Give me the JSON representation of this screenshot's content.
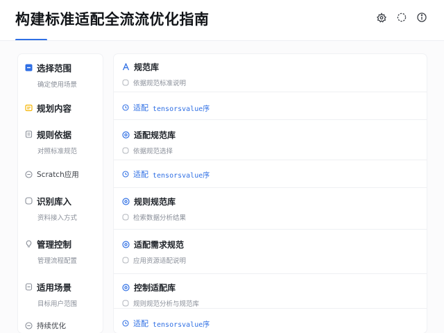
{
  "header": {
    "title": "构建标准适配全流流优化指南",
    "icons": [
      "settings-icon",
      "refresh-icon",
      "info-icon"
    ]
  },
  "sidebar": {
    "items": [
      {
        "label": "选择范围",
        "sub": "确定使用场景",
        "icon": "checkbox-icon",
        "accent": "#2f6fe4"
      },
      {
        "label": "规划内容",
        "sub": "",
        "icon": "note-icon",
        "accent": "#f5b400"
      },
      {
        "label": "规则依据",
        "sub": "对照标准规范",
        "icon": "doc-icon",
        "accent": "#8a8f99"
      },
      {
        "label": "Scratch应用",
        "sub": "",
        "icon": "minus-circle-icon",
        "accent": "#8a8f99"
      },
      {
        "label": "识别库入",
        "sub": "资料接入方式",
        "icon": "circle-icon",
        "accent": "#8a8f99"
      },
      {
        "label": "管理控制",
        "sub": "管理流程配置",
        "icon": "bulb-icon",
        "accent": "#8a8f99"
      },
      {
        "label": "适用场景",
        "sub": "目标用户范围",
        "icon": "file-icon",
        "accent": "#8a8f99"
      },
      {
        "label": "持续优化",
        "sub": "",
        "icon": "minus-circle-icon",
        "accent": "#8a8f99"
      }
    ]
  },
  "main": {
    "rows": [
      {
        "title": "规范库",
        "desc": "依据规范标准说明",
        "icon": "font-icon"
      },
      {
        "link_prefix": "适配",
        "link_code": "tensorsvalue序"
      },
      {
        "title": "适配规范库",
        "desc": "依据规范选择",
        "icon": "target-icon"
      },
      {
        "link_prefix": "适配",
        "link_code": "tensorsvalue序"
      },
      {
        "title": "规则规范库",
        "desc": "检索数据分析结果",
        "icon": "target-icon"
      },
      {
        "title": "适配需求规范",
        "desc": "应用资源适配说明",
        "icon": "target-icon"
      },
      {
        "title": "控制适配库",
        "desc": "规则规范分析与规范库",
        "icon": "target-icon"
      },
      {
        "link_prefix": "适配",
        "link_code": "tensorsvalue序"
      }
    ]
  },
  "colors": {
    "accent": "#2f6fe4",
    "muted_text": "#8a8f99",
    "divider": "#eef0f3"
  }
}
